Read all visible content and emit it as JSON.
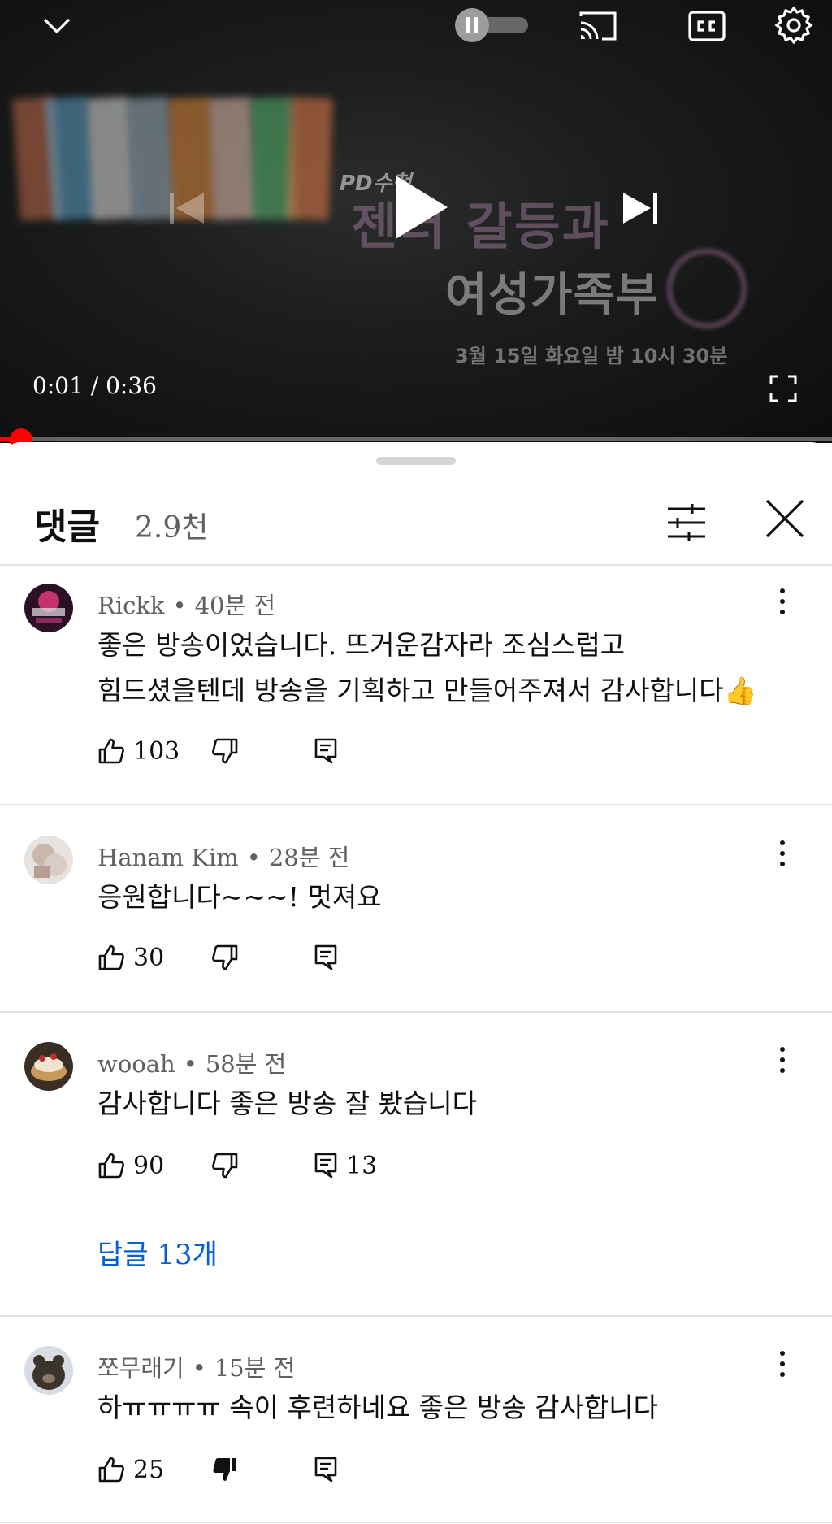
{
  "player": {
    "thumbnail": {
      "logo": "PD수첩",
      "line1": "젠더 갈등과",
      "line2": "여성가족부",
      "line3": "3월 15일 화요일 밤 10시 30분"
    },
    "time": "0:01 / 0:36",
    "progress_percent": 2.8,
    "autoplay_on": true,
    "icons": [
      "chevron-down-icon",
      "pause-icon",
      "cast-icon",
      "cc-icon",
      "gear-icon",
      "previous-icon",
      "play-icon",
      "next-icon",
      "fullscreen-icon"
    ]
  },
  "comments_panel": {
    "title": "댓글",
    "count": "2.9천",
    "comments": [
      {
        "author": "Rickk",
        "time": "40분 전",
        "text": "좋은 방송이었습니다. 뜨거운감자라 조심스럽고\n힘드셨을텐데 방송을 기획하고 만들어주져서 감사합니다",
        "emoji": "👍",
        "likes": "103",
        "replies": "",
        "disliked": false
      },
      {
        "author": "Hanam Kim",
        "time": "28분 전",
        "text": "응원합니다~~~! 멋져요",
        "likes": "30",
        "replies": "",
        "disliked": false
      },
      {
        "author": "wooah",
        "time": "58분 전",
        "text": "감사합니다 좋은 방송 잘 봤습니다",
        "likes": "90",
        "replies": "13",
        "replies_link": "답글 13개",
        "disliked": false
      },
      {
        "author": "쪼무래기",
        "time": "15분 전",
        "text": "하ㅠㅠㅠㅠ 속이 후련하네요 좋은 방송 감사합니다",
        "likes": "25",
        "replies": "",
        "disliked": true
      }
    ]
  },
  "colors": {
    "progress": "#ff0000",
    "link": "#065fd4",
    "meta": "#606060"
  }
}
